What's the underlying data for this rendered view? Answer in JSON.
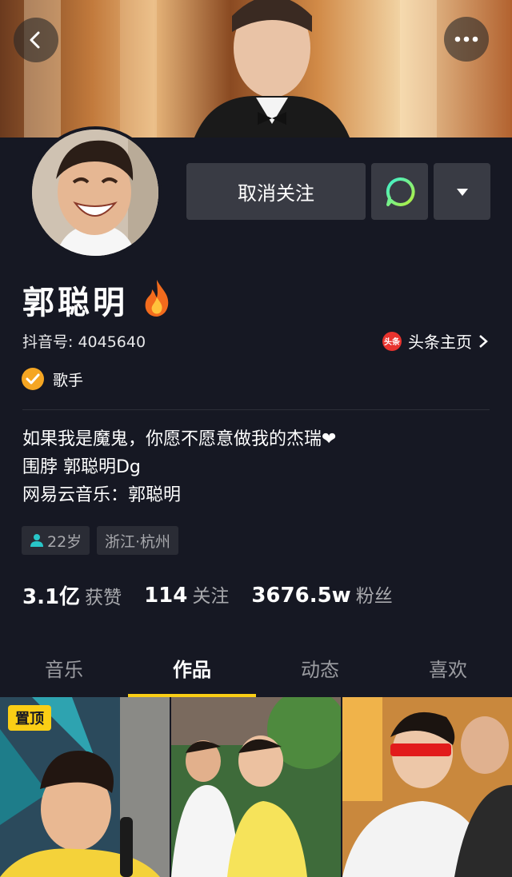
{
  "header": {
    "back_icon": "chevron-left-icon",
    "more_icon": "more-dots-icon"
  },
  "actions": {
    "unfollow_label": "取消关注",
    "message_icon": "chat-bubble-icon",
    "dropdown_icon": "triangle-down-icon"
  },
  "profile": {
    "name": "郭聪明",
    "douyin_id": "抖音号: 4045640",
    "toutiao_badge": "头条",
    "toutiao_link": "头条主页",
    "verify_label": "歌手",
    "bio": [
      "如果我是魔鬼，你愿不愿意做我的杰瑞❤",
      "围脖 郭聪明Dg",
      "网易云音乐：郭聪明"
    ],
    "tags": {
      "age": "22岁",
      "location": "浙江·杭州"
    }
  },
  "stats": [
    {
      "value": "3.1亿",
      "label": "获赞"
    },
    {
      "value": "114",
      "label": "关注"
    },
    {
      "value": "3676.5w",
      "label": "粉丝"
    }
  ],
  "tabs": [
    {
      "label": "音乐",
      "active": false
    },
    {
      "label": "作品",
      "active": true
    },
    {
      "label": "动态",
      "active": false
    },
    {
      "label": "喜欢",
      "active": false
    }
  ],
  "grid": {
    "pinned_label": "置顶"
  },
  "colors": {
    "background": "#161823",
    "accent": "#face15",
    "button": "#393b44",
    "verify": "#f5a623"
  }
}
